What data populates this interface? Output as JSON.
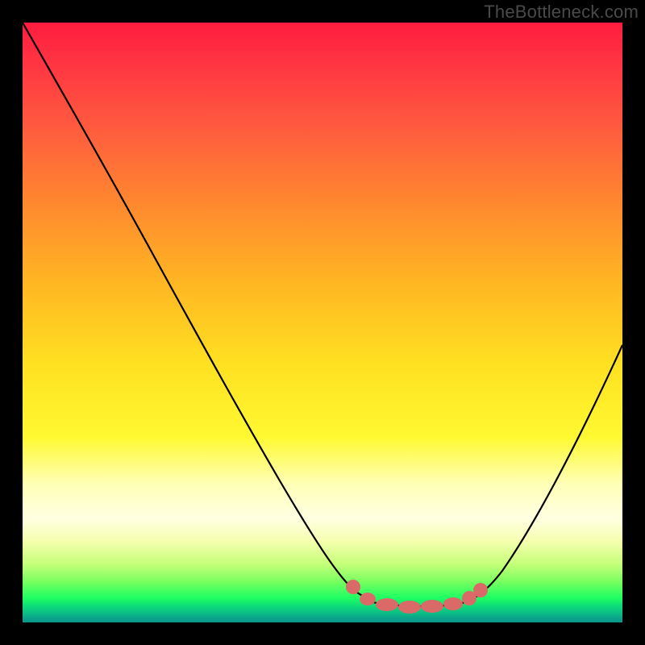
{
  "watermark": "TheBottleneck.com",
  "chart_data": {
    "type": "line",
    "title": "",
    "xlabel": "",
    "ylabel": "",
    "xlim": [
      0,
      100
    ],
    "ylim": [
      0,
      100
    ],
    "series": [
      {
        "name": "bottleneck-curve",
        "x": [
          0,
          12,
          24,
          36,
          48,
          55,
          60,
          65,
          70,
          75,
          80,
          88,
          100
        ],
        "y": [
          100,
          82,
          64,
          46,
          28,
          12,
          5,
          2,
          2,
          3,
          8,
          22,
          52
        ]
      }
    ],
    "markers": {
      "name": "highlight-dots",
      "color": "#d96a68",
      "points": [
        {
          "x": 55,
          "y": 6
        },
        {
          "x": 58,
          "y": 4
        },
        {
          "x": 60,
          "y": 3
        },
        {
          "x": 63,
          "y": 2
        },
        {
          "x": 67,
          "y": 2
        },
        {
          "x": 70,
          "y": 2
        },
        {
          "x": 73,
          "y": 3
        },
        {
          "x": 75,
          "y": 4
        }
      ]
    },
    "background_gradient": {
      "top": "#ff1c3e",
      "mid": "#ffe222",
      "bottom": "#0a9a8d"
    }
  }
}
